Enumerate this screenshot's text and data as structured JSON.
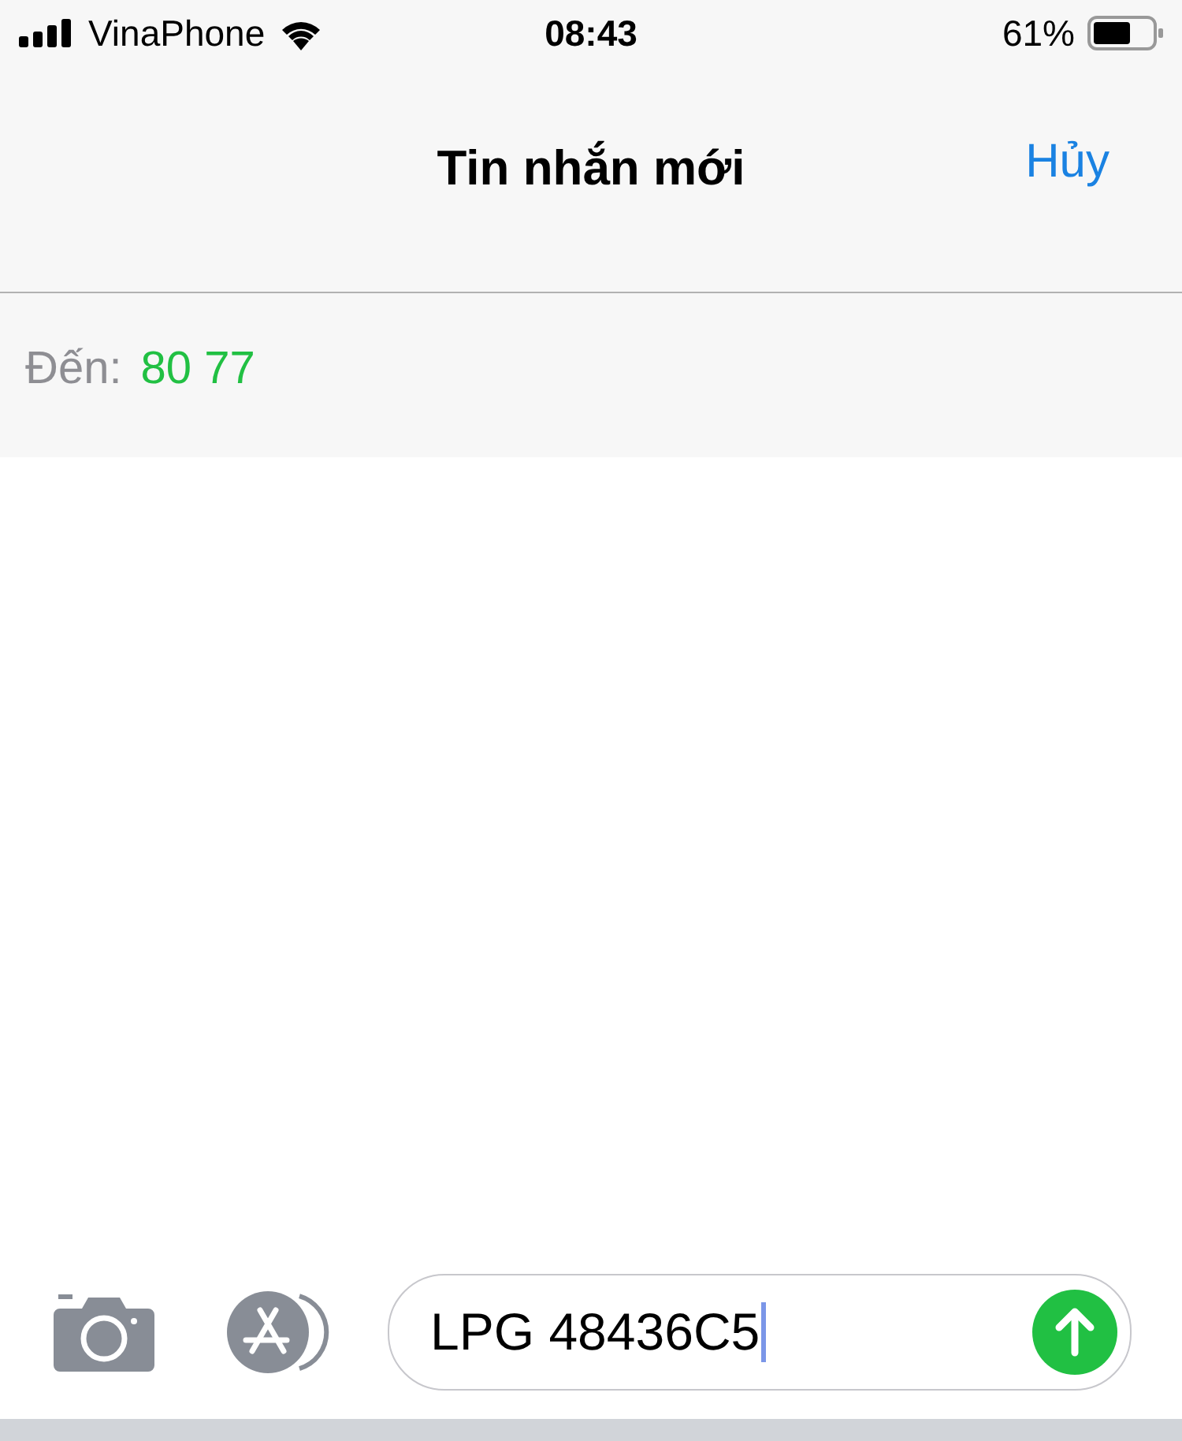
{
  "status_bar": {
    "carrier": "VinaPhone",
    "time": "08:43",
    "battery": "61%"
  },
  "nav": {
    "title": "Tin nhắn mới",
    "cancel": "Hủy"
  },
  "recipient": {
    "label": "Đến:",
    "value": "80 77"
  },
  "compose": {
    "value": "LPG 48436C5"
  }
}
